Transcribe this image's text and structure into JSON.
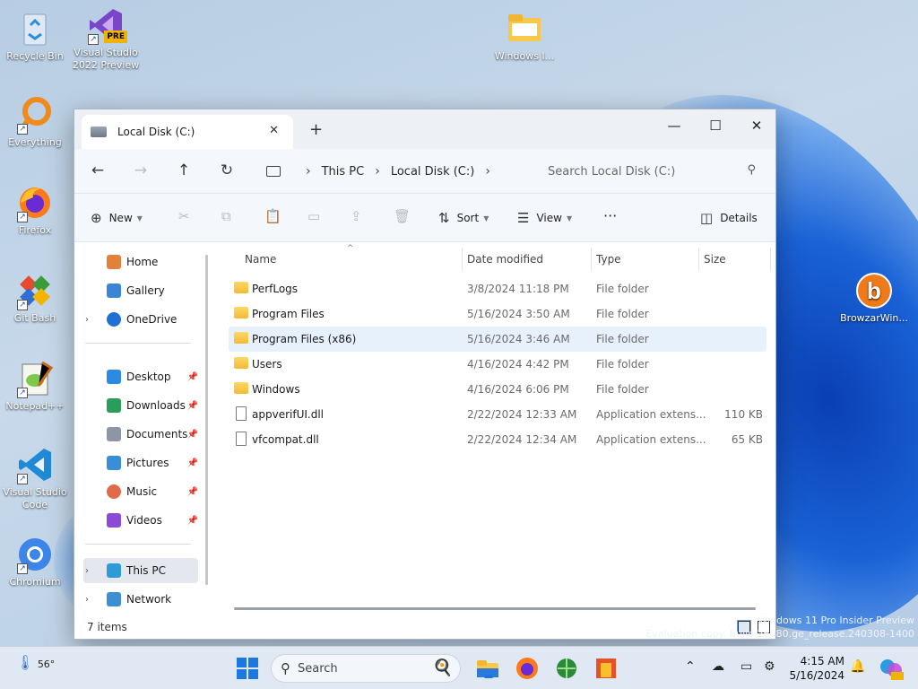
{
  "desktop": {
    "icons": [
      {
        "label": "Recycle Bin"
      },
      {
        "label": "Visual Studio 2022 Preview",
        "badge": "PRE"
      },
      {
        "label": "Everything"
      },
      {
        "label": "Firefox"
      },
      {
        "label": "Git Bash"
      },
      {
        "label": "Notepad++"
      },
      {
        "label": "Visual Studio Code"
      },
      {
        "label": "Chromium"
      },
      {
        "label": "Windows I..."
      },
      {
        "label": "BrowzarWin..."
      }
    ],
    "watermark_line1": "Windows 11 Pro Insider Preview",
    "watermark_line2": "Evaluation copy. Build 26080.ge_release.240308-1400"
  },
  "window": {
    "tab_title": "Local Disk (C:)",
    "address": [
      "This PC",
      "Local Disk (C:)"
    ],
    "search_placeholder": "Search Local Disk (C:)",
    "toolbar": {
      "new_label": "New",
      "sort_label": "Sort",
      "view_label": "View",
      "more_label": "···",
      "details_label": "Details"
    },
    "sidebar": {
      "top": [
        {
          "label": "Home"
        },
        {
          "label": "Gallery"
        },
        {
          "label": "OneDrive"
        }
      ],
      "quick": [
        {
          "label": "Desktop"
        },
        {
          "label": "Downloads"
        },
        {
          "label": "Documents"
        },
        {
          "label": "Pictures"
        },
        {
          "label": "Music"
        },
        {
          "label": "Videos"
        }
      ],
      "bottom": [
        {
          "label": "This PC"
        },
        {
          "label": "Network"
        }
      ]
    },
    "columns": {
      "name": "Name",
      "date": "Date modified",
      "type": "Type",
      "size": "Size"
    },
    "files": [
      {
        "name": "PerfLogs",
        "date": "3/8/2024 11:18 PM",
        "type": "File folder",
        "size": ""
      },
      {
        "name": "Program Files",
        "date": "5/16/2024 3:50 AM",
        "type": "File folder",
        "size": ""
      },
      {
        "name": "Program Files (x86)",
        "date": "5/16/2024 3:46 AM",
        "type": "File folder",
        "size": ""
      },
      {
        "name": "Users",
        "date": "4/16/2024 4:42 PM",
        "type": "File folder",
        "size": ""
      },
      {
        "name": "Windows",
        "date": "4/16/2024 6:06 PM",
        "type": "File folder",
        "size": ""
      },
      {
        "name": "appverifUI.dll",
        "date": "2/22/2024 12:33 AM",
        "type": "Application extens...",
        "size": "110 KB"
      },
      {
        "name": "vfcompat.dll",
        "date": "2/22/2024 12:34 AM",
        "type": "Application extens...",
        "size": "65 KB"
      }
    ],
    "status": "7 items"
  },
  "taskbar": {
    "temp": "56°",
    "search_label": "Search",
    "time": "4:15 AM",
    "date": "5/16/2024"
  }
}
